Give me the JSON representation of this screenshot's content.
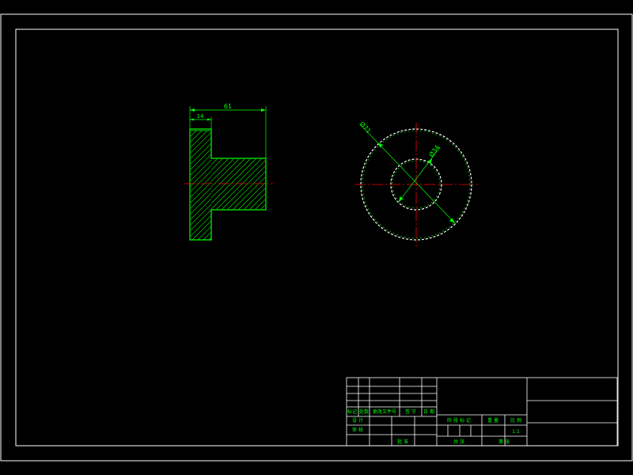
{
  "colors": {
    "background": "#000000",
    "border": "#ffffff",
    "outline": "#00ff00",
    "hatch": "#00ff00",
    "dimension": "#00ff00",
    "centerline": "#ff0000",
    "circle": "#ffffff",
    "text": "#00ff00"
  },
  "drawing": {
    "front_view": {
      "dimensions": {
        "overall_length": "61",
        "flange_thickness": "14"
      }
    },
    "side_view": {
      "dimensions": {
        "outer_diameter": "Ø71",
        "inner_diameter": "Ø34"
      }
    }
  },
  "title_block": {
    "rev_table_headers": [
      "标记",
      "处数",
      "更改文件号",
      "签 字",
      "日 期"
    ],
    "design_label": "设 计",
    "review_label": "审 核",
    "approve_label": "批 准",
    "stage_label": "阶 段 标 记",
    "weight_label": "重 量",
    "scale_label": "比 例",
    "scale_value": "1:1",
    "sheet_total_label": "共  张",
    "sheet_no_label": "第  张"
  }
}
